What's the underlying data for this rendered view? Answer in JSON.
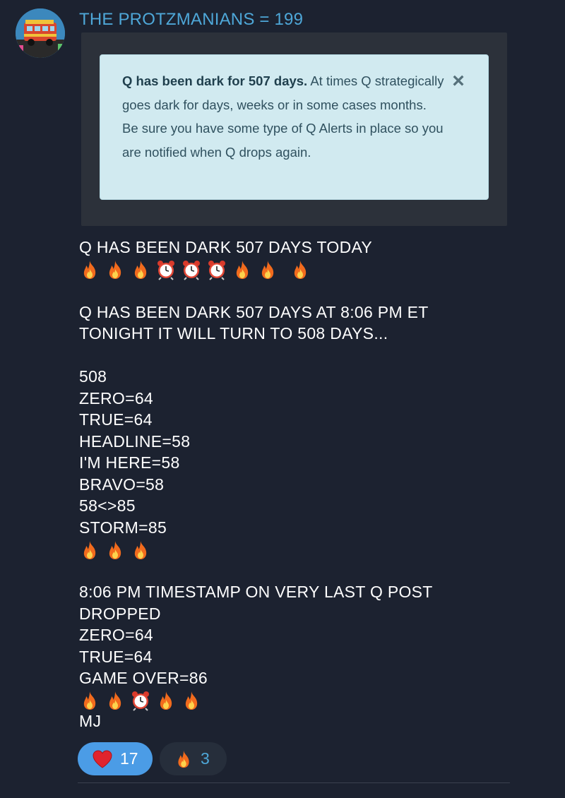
{
  "chat": {
    "sender_name": "THE PROTZMANIANS = 199",
    "avatar_icon": "group-avatar-bus-icon"
  },
  "alert": {
    "bold_text": "Q has been dark for 507 days.",
    "body_text": " At times Q strategically goes dark for days, weeks or in some cases months. Be sure you have some type of Q Alerts in place so you are notified when Q drops again.",
    "close_glyph": "×",
    "background_color": "#d1eaf0"
  },
  "message": {
    "line_1": "Q HAS BEEN DARK 507 DAYS TODAY",
    "emoji_row_1": [
      "fire",
      "fire",
      "fire",
      "alarm-clock",
      "alarm-clock",
      "alarm-clock",
      "fire",
      "fire",
      "fire"
    ],
    "line_2": "Q HAS BEEN DARK 507 DAYS AT 8:06 PM ET",
    "line_3": "TONIGHT IT WILL TURN TO 508 DAYS...",
    "line_4": "508",
    "line_5": "ZERO=64",
    "line_6": "TRUE=64",
    "line_7": "HEADLINE=58",
    "line_8": "I'M HERE=58",
    "line_9": "BRAVO=58",
    "line_10": "58<>85",
    "line_11": "STORM=85",
    "emoji_row_2": [
      "fire",
      "fire",
      "fire"
    ],
    "line_12": "8:06 PM TIMESTAMP ON VERY LAST Q POST",
    "line_13": "DROPPED",
    "line_14": "ZERO=64",
    "line_15": "TRUE=64",
    "line_16": "GAME OVER=86",
    "emoji_row_3": [
      "fire",
      "fire",
      "alarm-clock",
      "fire",
      "fire"
    ],
    "line_17": "MJ"
  },
  "reactions": [
    {
      "icon": "heart-icon",
      "count": "17",
      "active": true,
      "color": "#4b9ce6"
    },
    {
      "icon": "fire-icon",
      "count": "3",
      "active": false,
      "color": "#262e3b"
    }
  ],
  "colors": {
    "background": "#1c2230",
    "sender": "#4ea7d8",
    "preview_frame": "#2c313a"
  }
}
